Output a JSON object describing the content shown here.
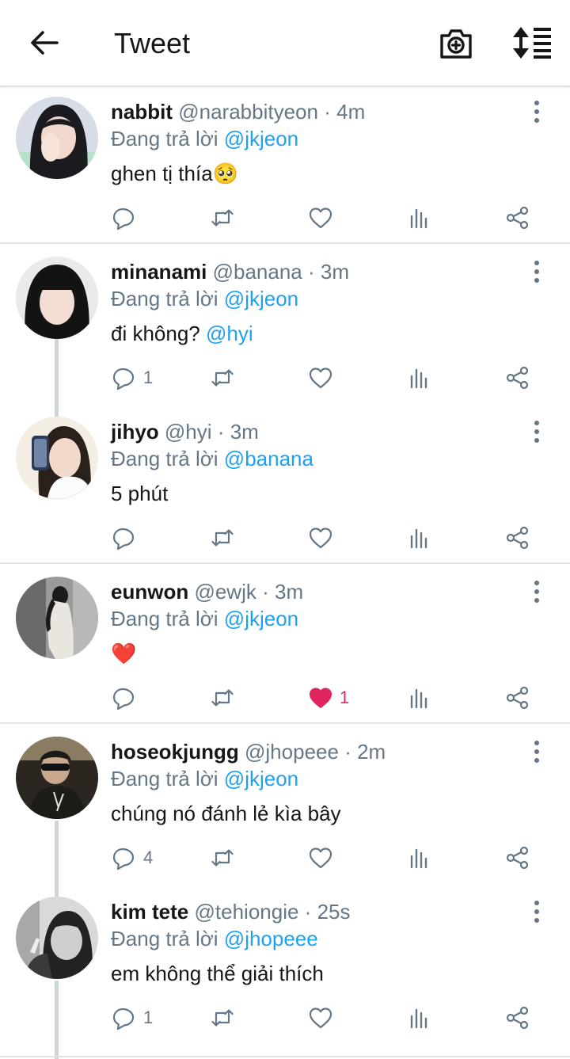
{
  "header": {
    "title": "Tweet",
    "back_icon": "arrow-left-icon",
    "camera_icon": "camera-plus-icon",
    "sort_icon": "sort-icon"
  },
  "reply_prefix": "Đang trả lời",
  "colors": {
    "accent": "#1da1f2",
    "muted": "#657786",
    "like": "#e0245e",
    "divider": "#e1e4e6"
  },
  "tweets": [
    {
      "name": "nabbit",
      "handle": "@narabbityeon",
      "sep": "·",
      "time": "4m",
      "reply_to": "@jkjeon",
      "text": "ghen tị thía🥺",
      "reply_count": "",
      "like_count": "",
      "liked": false
    },
    {
      "name": "minanami",
      "handle": "@banana",
      "sep": "·",
      "time": "3m",
      "reply_to": "@jkjeon",
      "text": "đi không? ",
      "mention": "@hyi",
      "reply_count": "1",
      "like_count": "",
      "liked": false
    },
    {
      "name": "jihyo",
      "handle": "@hyi",
      "sep": "·",
      "time": "3m",
      "reply_to": "@banana",
      "text": "5 phút",
      "reply_count": "",
      "like_count": "",
      "liked": false
    },
    {
      "name": "eunwon",
      "handle": "@ewjk",
      "sep": "·",
      "time": "3m",
      "reply_to": "@jkjeon",
      "text": "❤️",
      "reply_count": "",
      "like_count": "1",
      "liked": true
    },
    {
      "name": "hoseokjungg",
      "handle": "@jhopeee",
      "sep": "·",
      "time": "2m",
      "reply_to": "@jkjeon",
      "text": "chúng nó đánh lẻ kìa bây",
      "reply_count": "4",
      "like_count": "",
      "liked": false
    },
    {
      "name": "kim tete",
      "handle": "@tehiongie",
      "sep": "·",
      "time": "25s",
      "reply_to": "@jhopeee",
      "text": "em không thể giải thích",
      "reply_count": "1",
      "like_count": "",
      "liked": false
    }
  ]
}
